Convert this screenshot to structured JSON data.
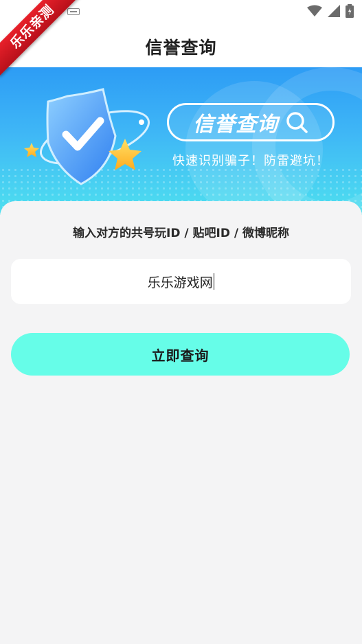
{
  "ribbon": {
    "label": "乐乐亲测"
  },
  "header": {
    "title": "信誉查询"
  },
  "banner": {
    "badge_text": "信誉查询",
    "tagline": "快速识别骗子！防雷避坑！"
  },
  "form": {
    "prompt": "输入对方的共号玩ID / 贴吧ID / 微博昵称",
    "input_value": "乐乐游戏网",
    "submit_label": "立即查询"
  },
  "colors": {
    "accent_button": "#66fde8",
    "banner_top": "#2d9cf5",
    "banner_bottom": "#4ee0ef",
    "ribbon": "#d8141e"
  },
  "icons": {
    "back": "back-arrow-icon",
    "search": "search-icon",
    "shield": "shield-check-icon",
    "star": "star-icon",
    "wifi": "wifi-icon",
    "signal": "signal-icon",
    "battery": "battery-icon"
  }
}
